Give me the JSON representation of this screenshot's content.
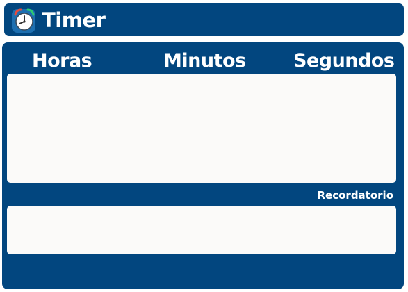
{
  "app": {
    "title": "Timer",
    "icon": "alarm-clock-icon"
  },
  "timer": {
    "hours_label": "Horas",
    "minutes_label": "Minutos",
    "seconds_label": "Segundos",
    "display_value": ""
  },
  "reminder": {
    "label": "Recordatorio",
    "value": ""
  },
  "colors": {
    "primary": "#02467f",
    "surface": "#fbfaf9",
    "text_on_primary": "#ffffff",
    "icon_tile": "#1d6fb0",
    "icon_ring": "#e74b3c",
    "icon_face": "#ffffff"
  }
}
